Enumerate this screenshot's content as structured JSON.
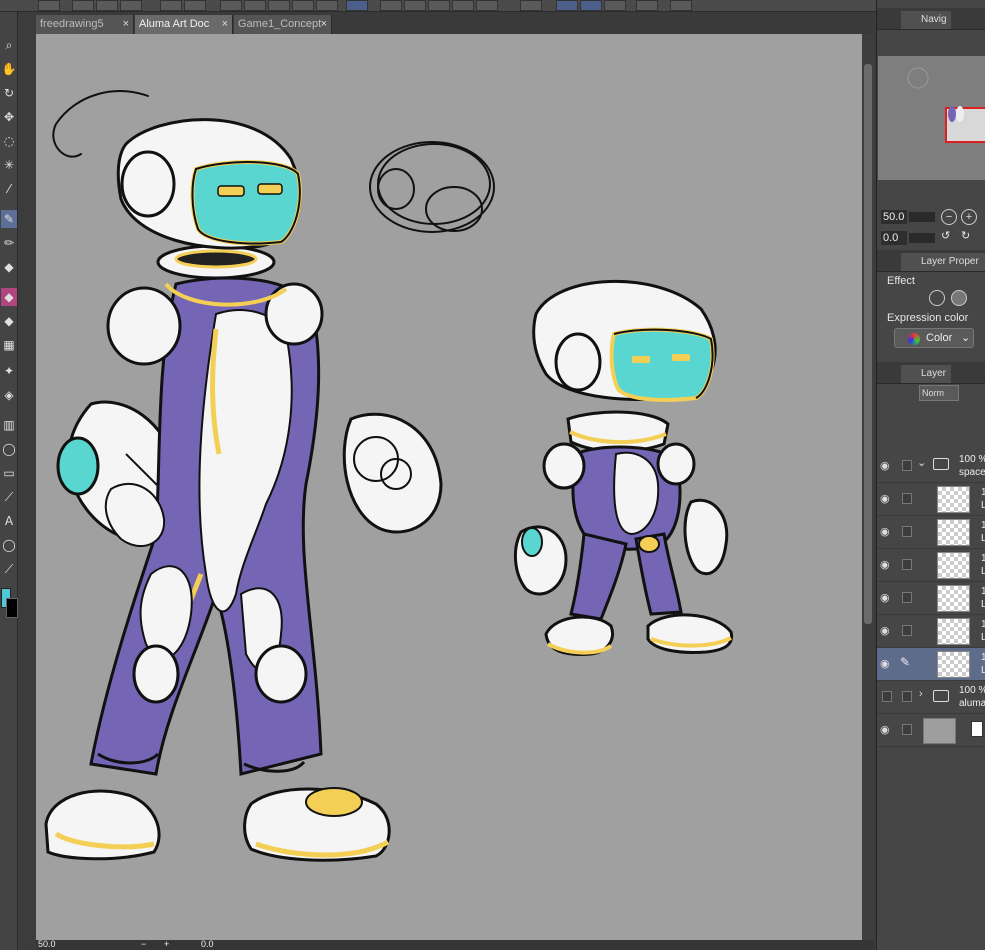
{
  "document_tabs": [
    {
      "label": "freedrawing5",
      "active": false
    },
    {
      "label": "Aluma Art Doc",
      "active": true
    },
    {
      "label": "Game1_Concept",
      "active": false
    }
  ],
  "close_glyph": "×",
  "navigator": {
    "tab_label": "Navig",
    "zoom_value": "50.0",
    "rotate_value": "0.0"
  },
  "layer_property": {
    "tab_label": "Layer Proper",
    "effect_label": "Effect",
    "expression_color_label": "Expression color",
    "expression_color_value": "Color"
  },
  "layer_panel": {
    "tab_label": "Layer",
    "blend_mode": "Norm",
    "layers": [
      {
        "opacity": "100 %",
        "name": "space",
        "kind": "folder",
        "visible": true,
        "expanded": true
      },
      {
        "opacity": "1",
        "name": "L",
        "kind": "raster",
        "visible": true
      },
      {
        "opacity": "1",
        "name": "L",
        "kind": "raster",
        "visible": true
      },
      {
        "opacity": "1",
        "name": "L",
        "kind": "raster",
        "visible": true
      },
      {
        "opacity": "1",
        "name": "L",
        "kind": "raster",
        "visible": true
      },
      {
        "opacity": "1",
        "name": "L",
        "kind": "raster",
        "visible": true
      },
      {
        "opacity": "1",
        "name": "L",
        "kind": "raster",
        "visible": true,
        "selected": true
      },
      {
        "opacity": "100 %",
        "name": "aluma",
        "kind": "folder",
        "visible": false,
        "expanded": false
      },
      {
        "opacity": "",
        "name": "",
        "kind": "paper",
        "visible": true
      }
    ]
  },
  "status_bar": {
    "zoom": "50.0",
    "rotation": "0.0",
    "zoom_out_glyph": "−",
    "zoom_in_glyph": "+"
  },
  "colors": {
    "canvas_bg": "#a0a0a0",
    "suit_purple": "#7465b5",
    "visor_cyan": "#59d6cf",
    "trim_yellow": "#f4cf55",
    "body_white": "#f5f5f5",
    "main_color_swatch": "#4fc8d8",
    "sub_color_swatch": "#000000",
    "selection_blue": "#5c6f96"
  },
  "icons": {
    "eye": "👁",
    "folder": "📁",
    "chevron_down": "⌄",
    "chevron_right": "›",
    "pencil": "✎"
  }
}
